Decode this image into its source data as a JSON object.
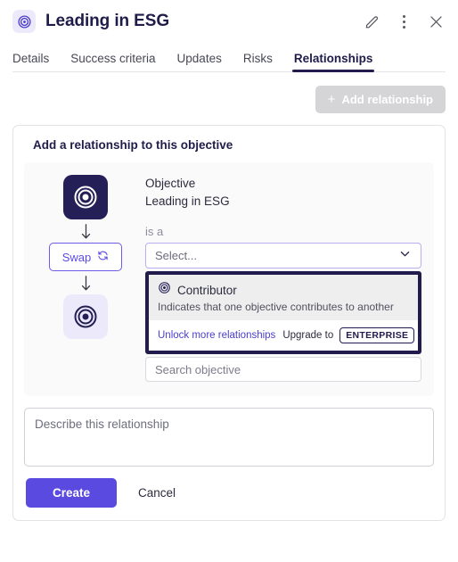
{
  "header": {
    "title": "Leading in ESG",
    "icon": "target-icon",
    "actions": [
      {
        "name": "edit-icon",
        "label": "Edit"
      },
      {
        "name": "more-options-icon",
        "label": "More options"
      },
      {
        "name": "close-icon",
        "label": "Close"
      }
    ]
  },
  "tabs": [
    {
      "label": "Details",
      "active": false
    },
    {
      "label": "Success criteria",
      "active": false
    },
    {
      "label": "Updates",
      "active": false
    },
    {
      "label": "Risks",
      "active": false
    },
    {
      "label": "Relationships",
      "active": true
    }
  ],
  "toolbar": {
    "add_relationship_label": "Add relationship",
    "add_icon": "plus-icon",
    "disabled": true
  },
  "card": {
    "title": "Add a relationship to this objective",
    "source": {
      "kind": "Objective",
      "name": "Leading in ESG",
      "icon": "target-icon"
    },
    "connector_label": "is a",
    "swap": {
      "label": "Swap",
      "icon": "swap-refresh-icon"
    },
    "target": {
      "icon": "target-icon"
    },
    "relationship_select": {
      "value": "",
      "placeholder": "Select...",
      "chevron": "chevron-down-icon",
      "expanded": true,
      "options": [
        {
          "title": "Contributor",
          "description": "Indicates that one objective contributes to another",
          "icon": "contributor-icon",
          "selected": true
        }
      ],
      "footer": {
        "link_label": "Unlock more relationships",
        "upgrade_label": "Upgrade to",
        "plan_badge": "ENTERPRISE"
      }
    },
    "objective_search": {
      "value": "",
      "placeholder": "Search objective"
    }
  },
  "description": {
    "value": "",
    "placeholder": "Describe this relationship"
  },
  "footer": {
    "create_label": "Create",
    "cancel_label": "Cancel"
  },
  "colors": {
    "brand_purple": "#5b4ae0",
    "navy": "#221c4e",
    "lavender": "#ece9fb",
    "disabled_gray": "#d5d5d8"
  }
}
